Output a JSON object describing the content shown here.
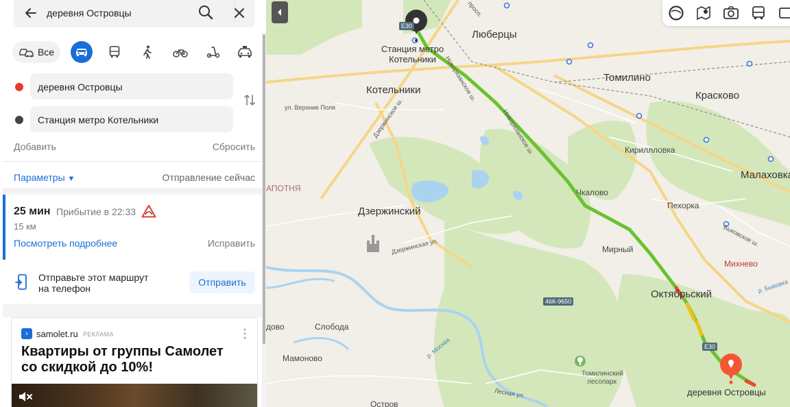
{
  "search": {
    "query": "деревня Островцы"
  },
  "modes": {
    "all_label": "Все"
  },
  "route": {
    "from": "деревня Островцы",
    "to": "Станция метро Котельники",
    "from_color": "#e8392c",
    "to_color": "#444444",
    "add_label": "Добавить",
    "reset_label": "Сбросить",
    "params_label": "Параметры",
    "depart_label": "Отправление сейчас"
  },
  "result": {
    "time": "25 мин",
    "arrival": "Прибытие в 22:33",
    "distance": "15 км",
    "details_label": "Посмотреть подробнее",
    "fix_label": "Исправить"
  },
  "phone": {
    "line1": "Отправьте этот маршрут",
    "line2": "на телефон",
    "send_label": "Отправить"
  },
  "ad": {
    "site": "samolet.ru",
    "ad_label": "РЕКЛАМА",
    "headline_1": "Квартиры от группы Самолет",
    "headline_2": "со скидкой до 10%!"
  },
  "map": {
    "labels": {
      "lyubertsy": "Люберцы",
      "kotelniki": "Котельники",
      "metro_1": "Станция метро",
      "metro_2": "Котельники",
      "tomilino": "Томилино",
      "kraskovo": "Красково",
      "kirillovka": "Кириллловка",
      "malakhovka": "Малаховка",
      "chkalovo": "Чкалово",
      "pekhorka": "Пехорка",
      "dzerzhinsky": "Дзержинский",
      "mirny": "Мирный",
      "mikhnevo": "Михнево",
      "oktyabrsky": "Октябрьский",
      "slobada": "Слобода",
      "mamonovo": "Мамоново",
      "ostrov": "Остров",
      "dest": "деревня Островцы",
      "kapotnya": "АПОТНЯ",
      "dovo": "дово",
      "park_1": "Томилинский",
      "park_2": "лесопарк",
      "street_verkhnie": "ул. Верхние Поля",
      "street_dzerzh_sh": "Дзержинское ш.",
      "street_dzerzh_ul": "Дзержинская ул.",
      "street_novoryaz_1": "Новорязанское ш.",
      "street_novoryaz_2": "Новорязанское ш.",
      "street_bykovskoe": "Быковское ш.",
      "street_lesnaya": "Лесная ул.",
      "street_moskva": "р. Москва",
      "street_bykovka": "р. Быковка",
      "street_prosp": "просп.",
      "road_46k": "46К-9650",
      "road_e30": "E30",
      "road_e30_top": "E30"
    }
  },
  "colors": {
    "accent": "#1a6ed8",
    "route_green": "#6ac22f",
    "route_yellow": "#f2c01a",
    "route_red": "#e84a2c",
    "water": "#aad3f0",
    "forest": "#cfe5b4"
  }
}
